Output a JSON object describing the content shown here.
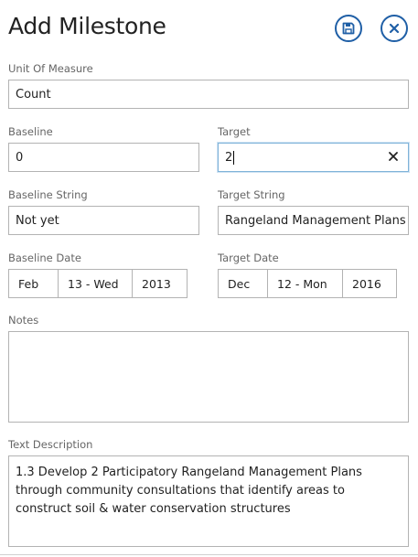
{
  "header": {
    "title": "Add Milestone",
    "save_icon": "floppy-disk-icon",
    "close_icon": "close-x-icon",
    "accent_color": "#1f5fa6"
  },
  "form": {
    "unit_of_measure": {
      "label": "Unit Of Measure",
      "value": "Count"
    },
    "baseline": {
      "label": "Baseline",
      "value": "0"
    },
    "target": {
      "label": "Target",
      "value": "2",
      "clear_icon": "clear-x-icon"
    },
    "baseline_string": {
      "label": "Baseline String",
      "value": "Not yet"
    },
    "target_string": {
      "label": "Target String",
      "value": "Rangeland Management Plans"
    },
    "baseline_date": {
      "label": "Baseline Date",
      "month": "Feb",
      "day": "13 - Wed",
      "year": "2013"
    },
    "target_date": {
      "label": "Target Date",
      "month": "Dec",
      "day": "12 - Mon",
      "year": "2016"
    },
    "notes": {
      "label": "Notes",
      "value": ""
    },
    "text_description": {
      "label": "Text Description",
      "value": "1.3 Develop 2 Participatory Rangeland Management Plans through community consultations that identify areas to construct soil & water conservation structures"
    }
  }
}
